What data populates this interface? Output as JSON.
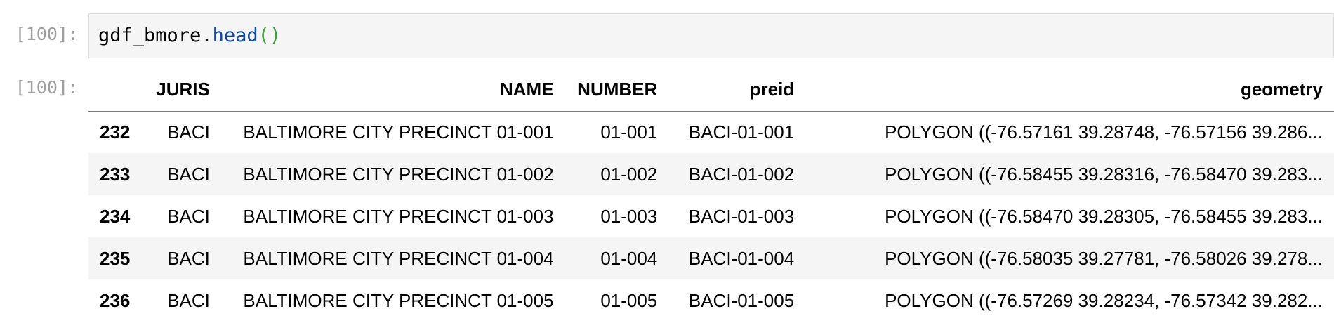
{
  "input_cell": {
    "prompt": "[100]:",
    "code": {
      "variable": "gdf_bmore",
      "dot": ".",
      "method": "head",
      "parens": "()"
    }
  },
  "output_cell": {
    "prompt": "[100]:",
    "table": {
      "columns": [
        "",
        "JURIS",
        "NAME",
        "NUMBER",
        "preid",
        "geometry"
      ],
      "rows": [
        {
          "index": "232",
          "juris": "BACI",
          "name": "BALTIMORE CITY PRECINCT 01-001",
          "number": "01-001",
          "preid": "BACI-01-001",
          "geometry": "POLYGON ((-76.57161 39.28748, -76.57156 39.286..."
        },
        {
          "index": "233",
          "juris": "BACI",
          "name": "BALTIMORE CITY PRECINCT 01-002",
          "number": "01-002",
          "preid": "BACI-01-002",
          "geometry": "POLYGON ((-76.58455 39.28316, -76.58470 39.283..."
        },
        {
          "index": "234",
          "juris": "BACI",
          "name": "BALTIMORE CITY PRECINCT 01-003",
          "number": "01-003",
          "preid": "BACI-01-003",
          "geometry": "POLYGON ((-76.58470 39.28305, -76.58455 39.283..."
        },
        {
          "index": "235",
          "juris": "BACI",
          "name": "BALTIMORE CITY PRECINCT 01-004",
          "number": "01-004",
          "preid": "BACI-01-004",
          "geometry": "POLYGON ((-76.58035 39.27781, -76.58026 39.278..."
        },
        {
          "index": "236",
          "juris": "BACI",
          "name": "BALTIMORE CITY PRECINCT 01-005",
          "number": "01-005",
          "preid": "BACI-01-005",
          "geometry": "POLYGON ((-76.57269 39.28234, -76.57342 39.282..."
        }
      ]
    }
  },
  "colors": {
    "prompt": "#9e9e9e",
    "code_background": "#f5f5f5",
    "method": "#0d47a1",
    "parens": "#3aa33a",
    "striped_row": "#f5f5f5"
  }
}
